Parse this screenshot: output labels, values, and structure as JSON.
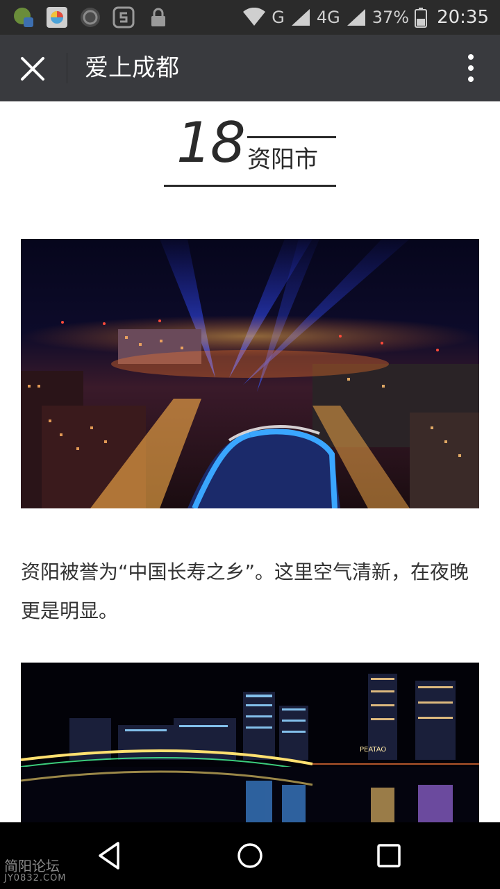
{
  "status_bar": {
    "left_icons": [
      "app-notification-icon",
      "browser-notification-icon",
      "circle-app-icon",
      "s-app-icon",
      "lock-icon"
    ],
    "network": "G",
    "network_2": "4G",
    "battery": "37%",
    "time": "20:35"
  },
  "app_bar": {
    "title": "爱上成都"
  },
  "article": {
    "number": "18",
    "city": "资阳市",
    "paragraph": "资阳被誉为“中国长寿之乡”。这里空气清新，在夜晚更是明显。"
  },
  "photo2": {
    "sign_text": "PEATAO"
  },
  "watermark": {
    "line1": "简阳论坛",
    "line2": "JY0832.COM"
  }
}
